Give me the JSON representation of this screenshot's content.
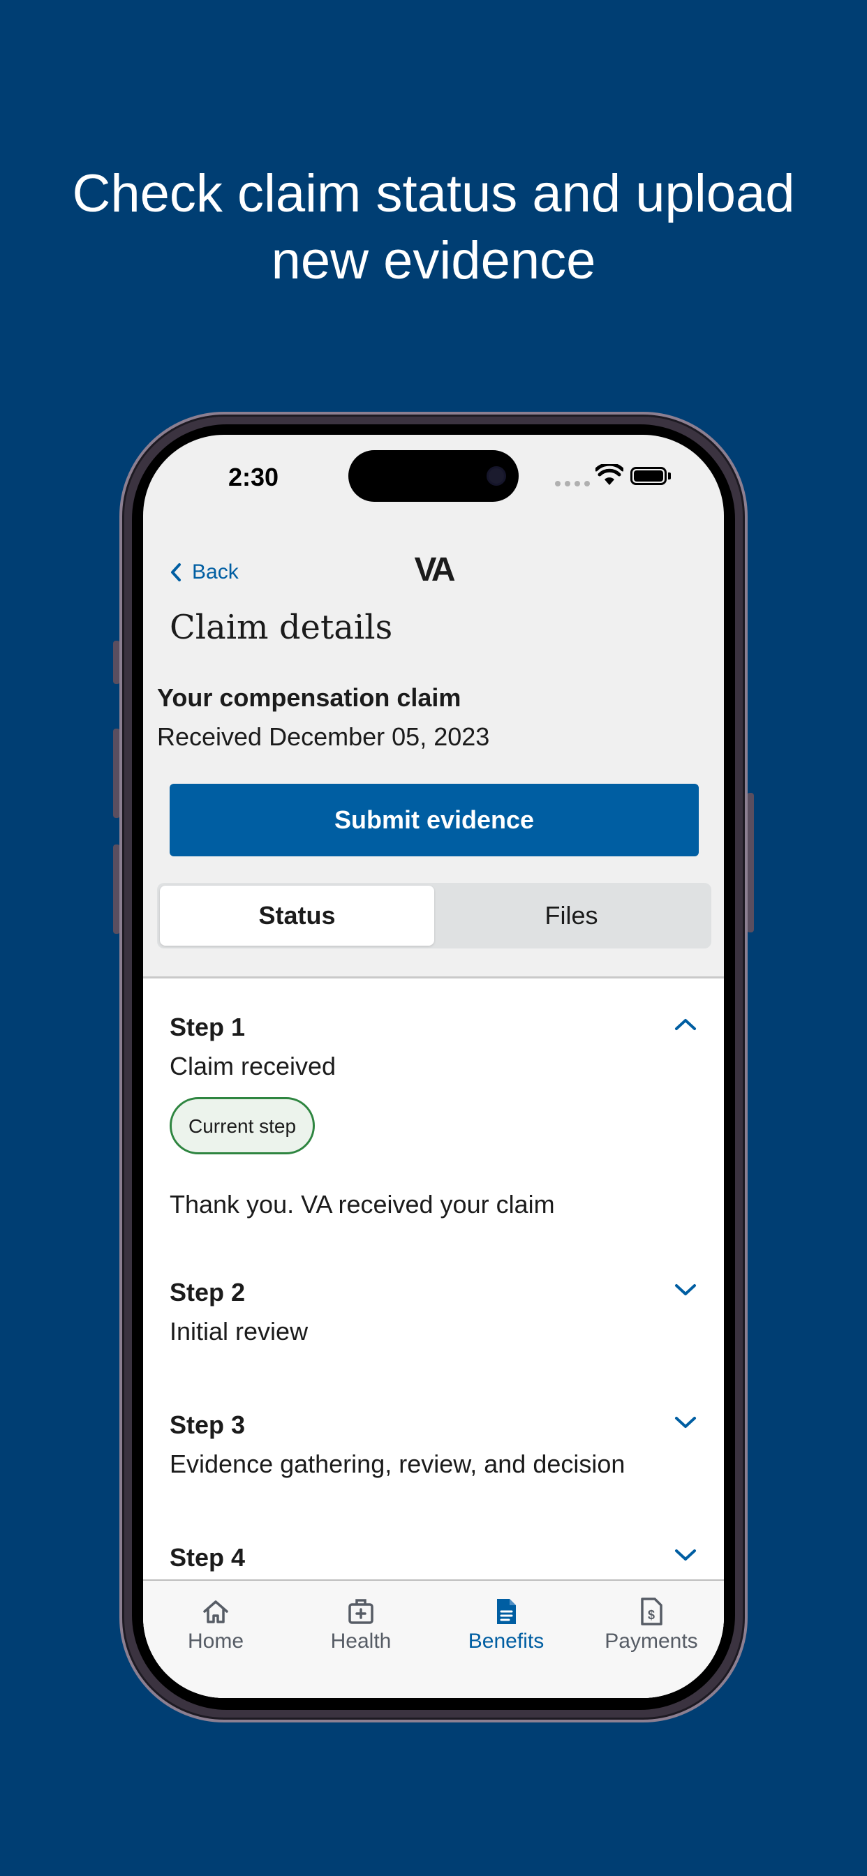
{
  "headline": {
    "line1": "Check claim status and upload",
    "line2": "new evidence"
  },
  "status_bar": {
    "time": "2:30"
  },
  "nav": {
    "back_label": "Back",
    "logo": "VA"
  },
  "page": {
    "title": "Claim details",
    "claim_title": "Your compensation claim",
    "claim_date": "Received December 05, 2023",
    "submit_label": "Submit evidence"
  },
  "segments": [
    {
      "label": "Status",
      "selected": true
    },
    {
      "label": "Files",
      "selected": false
    }
  ],
  "steps": [
    {
      "label": "Step 1",
      "desc": "Claim received",
      "expanded": true,
      "badge": "Current step",
      "message": "Thank you. VA received your claim"
    },
    {
      "label": "Step 2",
      "desc": "Initial review",
      "expanded": false
    },
    {
      "label": "Step 3",
      "desc": "Evidence gathering, review, and decision",
      "expanded": false
    },
    {
      "label": "Step 4",
      "expanded": false
    }
  ],
  "tabbar": [
    {
      "label": "Home",
      "icon": "home-icon",
      "active": false
    },
    {
      "label": "Health",
      "icon": "medical-kit-icon",
      "active": false
    },
    {
      "label": "Benefits",
      "icon": "document-icon",
      "active": true
    },
    {
      "label": "Payments",
      "icon": "dollar-document-icon",
      "active": false
    }
  ],
  "colors": {
    "background": "#003e73",
    "primary": "#005ea2",
    "badge_border": "#2e8540",
    "badge_fill": "#ecf3ec"
  }
}
